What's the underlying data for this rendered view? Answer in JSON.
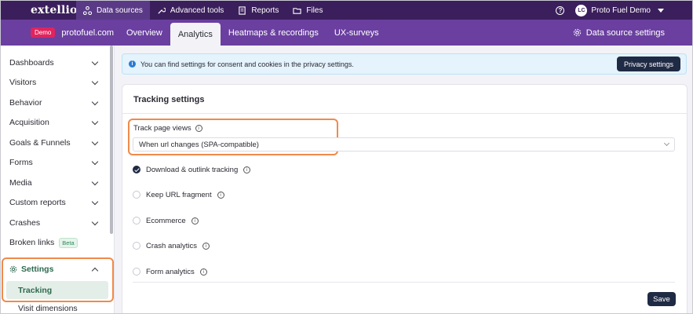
{
  "topbar": {
    "logo": "extellio",
    "nav": [
      {
        "label": "Data sources",
        "icon": "data-sources-icon"
      },
      {
        "label": "Advanced tools",
        "icon": "wrench-icon"
      },
      {
        "label": "Reports",
        "icon": "report-icon"
      },
      {
        "label": "Files",
        "icon": "folder-icon"
      }
    ],
    "help": "?",
    "user_initials": "LC",
    "user_name": "Proto Fuel Demo"
  },
  "subbar": {
    "demo_badge": "Demo",
    "site": "protofuel.com",
    "tabs": [
      "Overview",
      "Analytics",
      "Heatmaps & recordings",
      "UX-surveys"
    ],
    "active_tab": "Analytics",
    "data_source_settings": "Data source settings"
  },
  "sidebar": {
    "items": [
      {
        "label": "Dashboards"
      },
      {
        "label": "Visitors"
      },
      {
        "label": "Behavior"
      },
      {
        "label": "Acquisition"
      },
      {
        "label": "Goals & Funnels"
      },
      {
        "label": "Forms"
      },
      {
        "label": "Media"
      },
      {
        "label": "Custom reports"
      },
      {
        "label": "Crashes"
      }
    ],
    "broken_links": "Broken links",
    "beta": "Beta",
    "settings": "Settings",
    "tracking": "Tracking",
    "visit_dimensions": "Visit dimensions"
  },
  "info": {
    "text": "You can find settings for consent and cookies in the privacy settings.",
    "button": "Privacy settings"
  },
  "tracking_settings": {
    "title": "Tracking settings",
    "track_page_views_label": "Track page views",
    "track_page_views_value": "When url changes (SPA-compatible)",
    "options": [
      {
        "label": "Download & outlink tracking",
        "checked": true
      },
      {
        "label": "Keep URL fragment",
        "checked": false
      },
      {
        "label": "Ecommerce",
        "checked": false
      },
      {
        "label": "Crash analytics",
        "checked": false
      },
      {
        "label": "Form analytics",
        "checked": false
      }
    ],
    "save": "Save"
  },
  "colors": {
    "topbar": "#3b1f5c",
    "subbar": "#6a3fa0",
    "highlight": "#f08a4b",
    "accent_green": "#2d6a4f",
    "button_dark": "#1f2a44"
  }
}
